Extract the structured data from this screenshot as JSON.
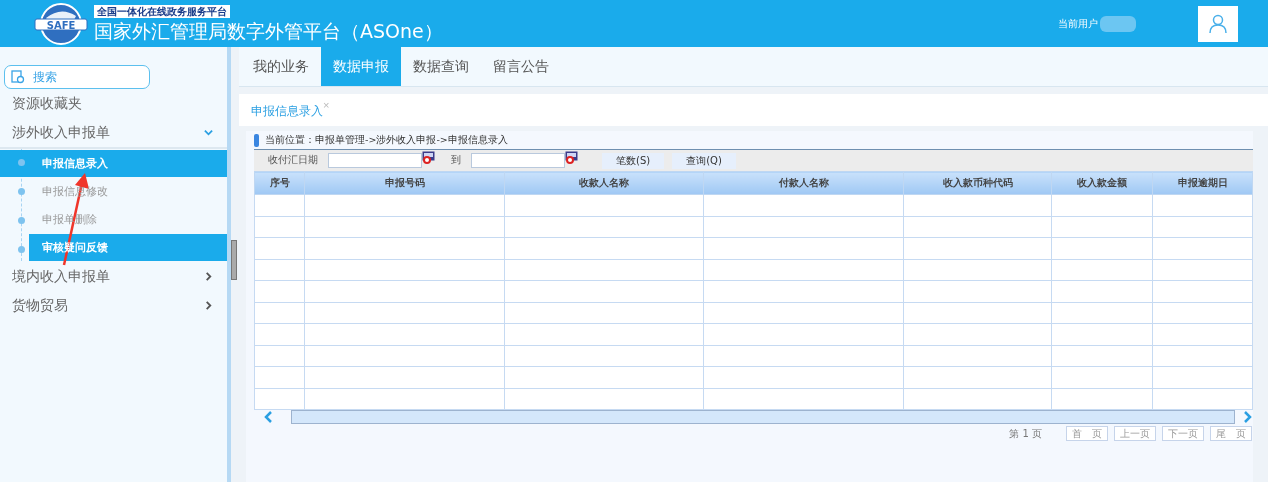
{
  "header": {
    "subtitle": "全国一体化在线政务服务平台",
    "title": "国家外汇管理局数字外管平台（ASOne）",
    "logo_text": "SAFE",
    "user_label": "当前用户"
  },
  "sidebar": {
    "search": "搜索",
    "items": [
      {
        "label": "资源收藏夹",
        "kind": "link"
      },
      {
        "label": "涉外收入申报单",
        "kind": "group",
        "expanded": true,
        "children": [
          {
            "label": "申报信息录入",
            "selected": true
          },
          {
            "label": "申报信息修改",
            "selected": false
          },
          {
            "label": "申报单删除",
            "selected": false
          },
          {
            "label": "审核疑问反馈",
            "selected": true
          }
        ]
      },
      {
        "label": "境内收入申报单",
        "kind": "group",
        "expanded": false
      },
      {
        "label": "货物贸易",
        "kind": "group",
        "expanded": false
      }
    ]
  },
  "tabs": [
    {
      "label": "我的业务",
      "selected": false
    },
    {
      "label": "数据申报",
      "selected": true
    },
    {
      "label": "数据查询",
      "selected": false
    },
    {
      "label": "留言公告",
      "selected": false
    }
  ],
  "page_tab": {
    "label": "申报信息录入",
    "close": "×"
  },
  "breadcrumb": "当前位置：申报单管理->涉外收入申报->申报信息录入",
  "filter": {
    "label": "收付汇日期",
    "to_label": "到",
    "buttons": [
      "笔数(S)",
      "查询(Q)"
    ]
  },
  "table": {
    "columns": [
      "序号",
      "申报号码",
      "收款人名称",
      "付款人名称",
      "收入款币种代码",
      "收入款金额",
      "申报逾期日"
    ]
  },
  "pagination": {
    "page_label": "第 1 页",
    "buttons": [
      {
        "label": "首　页",
        "disabled": true
      },
      {
        "label": "上一页",
        "disabled": true
      },
      {
        "label": "下一页",
        "disabled": true
      },
      {
        "label": "尾　页",
        "disabled": true
      }
    ]
  }
}
